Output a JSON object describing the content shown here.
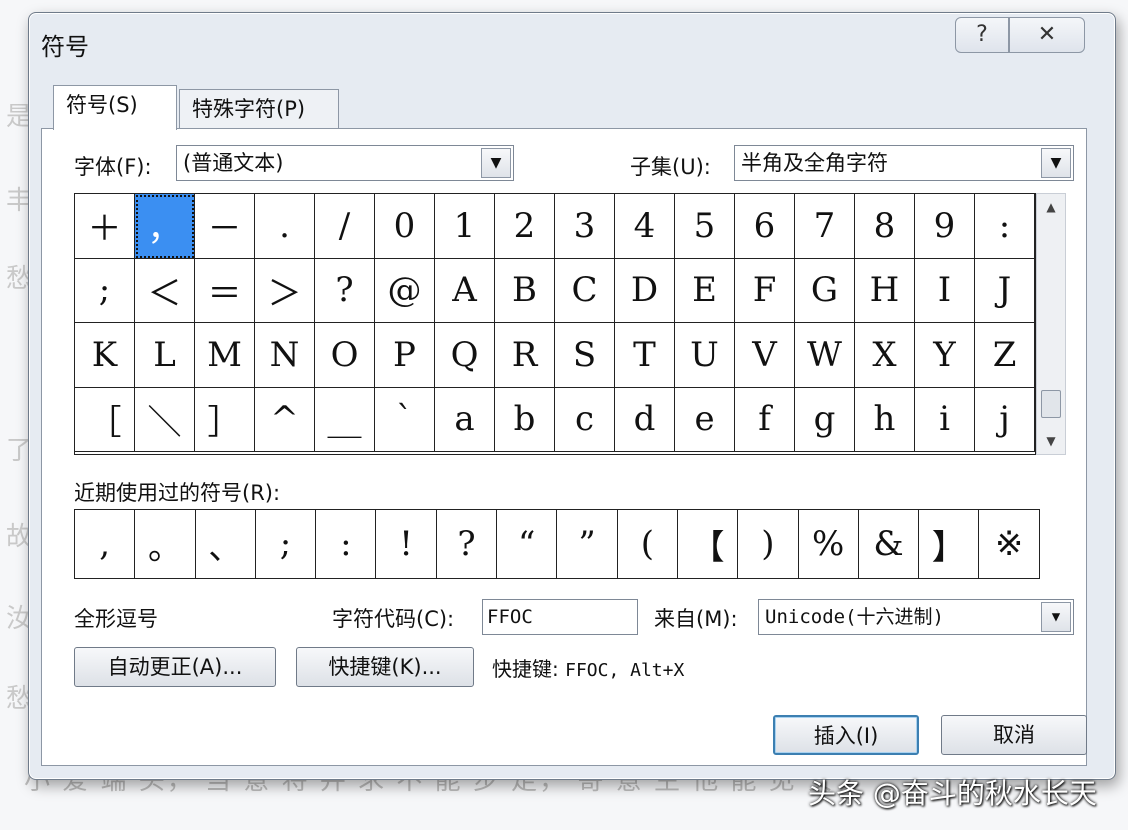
{
  "dialog": {
    "title": "符号",
    "help_label": "?",
    "close_label": "✕",
    "tabs": [
      {
        "label": "符号(S)",
        "active": true
      },
      {
        "label": "特殊字符(P)",
        "active": false
      }
    ],
    "font_label": "字体(F):",
    "font_value": "(普通文本)",
    "subset_label": "子集(U):",
    "subset_value": "半角及全角字符",
    "symbols": [
      [
        "＋",
        "，",
        "－",
        ".",
        "/",
        "0",
        "1",
        "2",
        "3",
        "4",
        "5",
        "6",
        "7",
        "8",
        "9",
        ":"
      ],
      [
        ";",
        "＜",
        "＝",
        "＞",
        "?",
        "@",
        "A",
        "B",
        "C",
        "D",
        "E",
        "F",
        "G",
        "H",
        "I",
        "J"
      ],
      [
        "K",
        "L",
        "M",
        "N",
        "O",
        "P",
        "Q",
        "R",
        "S",
        "T",
        "U",
        "V",
        "W",
        "X",
        "Y",
        "Z"
      ],
      [
        "［",
        "＼",
        "］",
        "^",
        "＿",
        "`",
        "a",
        "b",
        "c",
        "d",
        "e",
        "f",
        "g",
        "h",
        "i",
        "j"
      ]
    ],
    "selected_symbol": "，",
    "recent_label": "近期使用过的符号(R):",
    "recent": [
      ",",
      "。",
      "、",
      ";",
      ":",
      "!",
      "?",
      "“",
      "”",
      "(",
      "【",
      ")",
      "%",
      "&",
      "】",
      "※"
    ],
    "char_name": "全形逗号",
    "char_code_label": "字符代码(C):",
    "char_code_value": "FFOC",
    "from_label": "来自(M):",
    "from_value": "Unicode(十六进制)",
    "autocorrect_label": "自动更正(A)...",
    "shortcut_key_label": "快捷键(K)...",
    "shortcut_text_prefix": "快捷键:",
    "shortcut_text_value": "FFOC, Alt+X",
    "insert_label": "插入(I)",
    "cancel_label": "取消"
  },
  "background": {
    "side_chars": [
      "是",
      "丰",
      "愁",
      "了",
      "故",
      "汝",
      "愁"
    ],
    "bottom_line": "小 爱 端 头，  当 意 将 并 求 不 能 步 走，  寄 意 生 他 能 见 安"
  },
  "watermark": "头条 @奋斗的秋水长天"
}
